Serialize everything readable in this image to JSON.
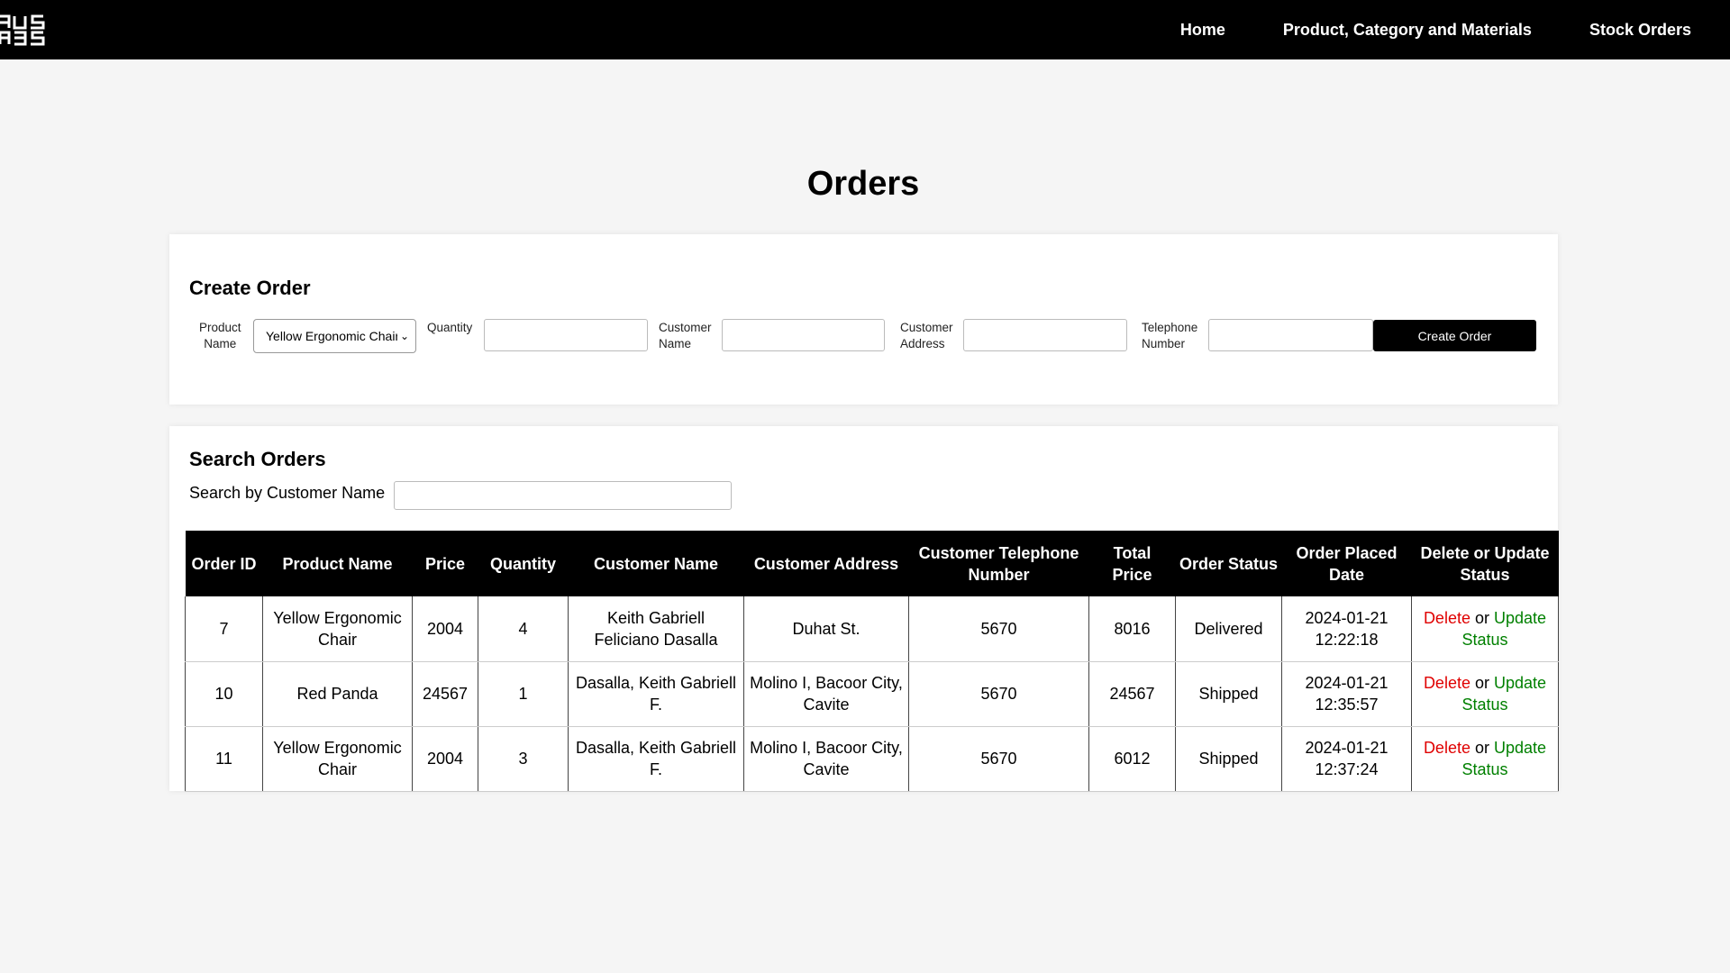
{
  "nav": {
    "logo_alt": "AUS ABS",
    "links": [
      "Home",
      "Product, Category and Materials",
      "Stock Orders"
    ]
  },
  "page": {
    "title": "Orders"
  },
  "create_order": {
    "title": "Create Order",
    "product_label_1": "Product",
    "product_label_2": "Name",
    "product_selected": "Yellow Ergonomic Chair",
    "quantity_label": "Quantity",
    "customer_name_label_1": "Customer",
    "customer_name_label_2": "Name",
    "customer_address_label_1": "Customer",
    "customer_address_label_2": "Address",
    "telephone_label_1": "Telephone",
    "telephone_label_2": "Number",
    "button_label": "Create Order"
  },
  "search": {
    "title": "Search Orders",
    "label": "Search by Customer Name",
    "value": ""
  },
  "table": {
    "headers": [
      "Order ID",
      "Product Name",
      "Price",
      "Quantity",
      "Customer Name",
      "Customer Address",
      "Customer Telephone Number",
      "Total Price",
      "Order Status",
      "Order Placed Date",
      "Delete or Update Status"
    ],
    "rows": [
      {
        "id": "7",
        "product": "Yellow Ergonomic Chair",
        "price": "2004",
        "quantity": "4",
        "customer": "Keith Gabriell Feliciano Dasalla",
        "address": "Duhat St.",
        "phone": "5670",
        "total": "8016",
        "status": "Delivered",
        "date": "2024-01-21 12:22:18"
      },
      {
        "id": "10",
        "product": "Red Panda",
        "price": "24567",
        "quantity": "1",
        "customer": "Dasalla, Keith Gabriell F.",
        "address": "Molino I, Bacoor City, Cavite",
        "phone": "5670",
        "total": "24567",
        "status": "Shipped",
        "date": "2024-01-21 12:35:57"
      },
      {
        "id": "11",
        "product": "Yellow Ergonomic Chair",
        "price": "2004",
        "quantity": "3",
        "customer": "Dasalla, Keith Gabriell F.",
        "address": "Molino I, Bacoor City, Cavite",
        "phone": "5670",
        "total": "6012",
        "status": "Shipped",
        "date": "2024-01-21 12:37:24"
      }
    ],
    "action_delete": "Delete",
    "action_or": "or",
    "action_update": "Update Status"
  }
}
